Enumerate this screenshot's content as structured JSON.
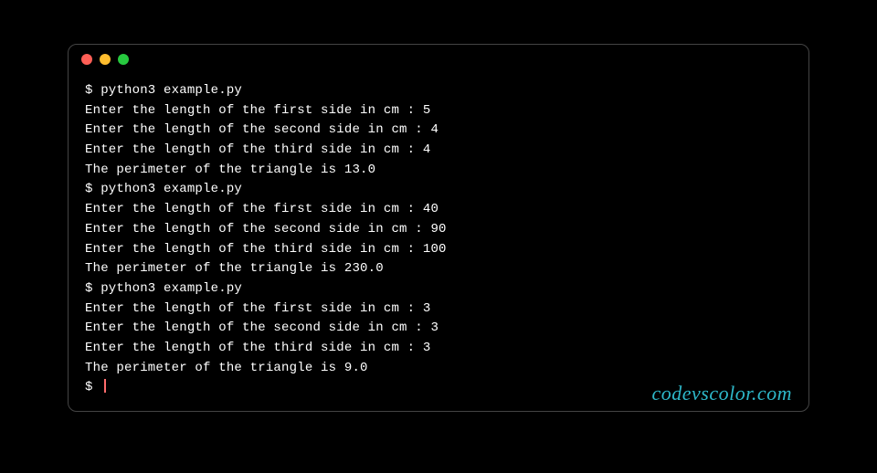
{
  "window": {
    "traffic_lights": {
      "close": "close",
      "minimize": "minimize",
      "zoom": "zoom"
    }
  },
  "terminal": {
    "prompt": "$ ",
    "lines": [
      "$ python3 example.py",
      "Enter the length of the first side in cm : 5",
      "Enter the length of the second side in cm : 4",
      "Enter the length of the third side in cm : 4",
      "The perimeter of the triangle is 13.0",
      "$ python3 example.py",
      "Enter the length of the first side in cm : 40",
      "Enter the length of the second side in cm : 90",
      "Enter the length of the third side in cm : 100",
      "The perimeter of the triangle is 230.0",
      "$ python3 example.py",
      "Enter the length of the first side in cm : 3",
      "Enter the length of the second side in cm : 3",
      "Enter the length of the third side in cm : 3",
      "The perimeter of the triangle is 9.0"
    ],
    "active_prompt": "$ "
  },
  "watermark": "codevscolor.com"
}
